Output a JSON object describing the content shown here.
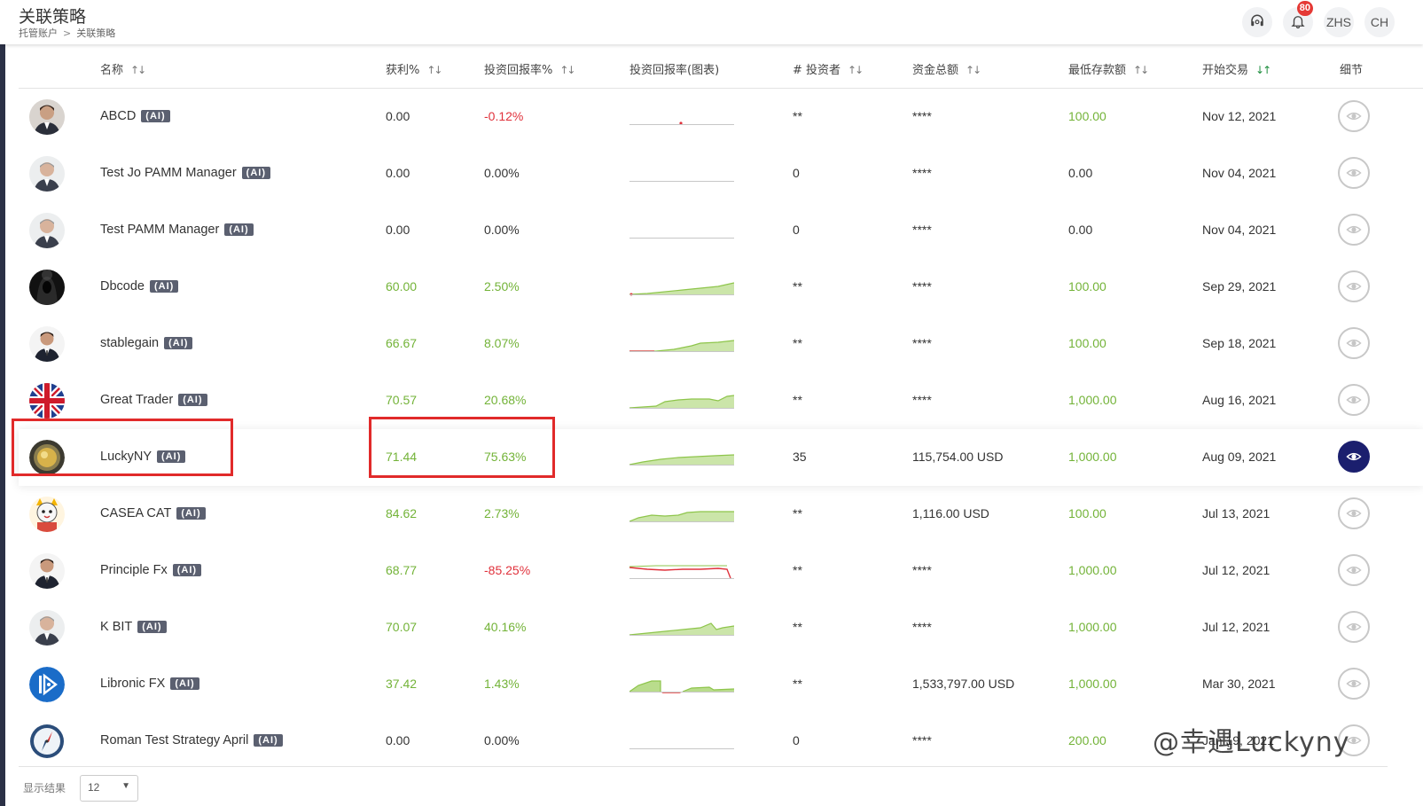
{
  "header": {
    "title": "关联策略",
    "breadcrumb": [
      "托管账户",
      "关联策略"
    ],
    "breadcrumb_sep": ">",
    "notification_count": "80",
    "lang_label": "ZHS",
    "user_label": "CH"
  },
  "columns": {
    "name": "名称",
    "profit": "获利%",
    "roi": "投资回报率%",
    "roi_chart": "投资回报率(图表)",
    "investors": "# 投资者",
    "total_funds": "资金总额",
    "min_deposit": "最低存款额",
    "start": "开始交易",
    "details": "细节"
  },
  "ai_badge": "(AI)",
  "rows": [
    {
      "name": "ABCD",
      "profit": "0.00",
      "roi": "-0.12%",
      "investors": "**",
      "funds": "****",
      "min_deposit": "100.00",
      "start": "Nov 12, 2021",
      "profit_color": "neutral",
      "roi_color": "red",
      "min_color": "green",
      "avatar": "man-portrait-icon",
      "spark": "flat-dot"
    },
    {
      "name": "Test Jo PAMM Manager",
      "profit": "0.00",
      "roi": "0.00%",
      "investors": "0",
      "funds": "****",
      "min_deposit": "0.00",
      "start": "Nov 04, 2021",
      "profit_color": "neutral",
      "roi_color": "neutral",
      "min_color": "neutral",
      "avatar": "man-grey-portrait-icon",
      "spark": "flat"
    },
    {
      "name": "Test PAMM Manager",
      "profit": "0.00",
      "roi": "0.00%",
      "investors": "0",
      "funds": "****",
      "min_deposit": "0.00",
      "start": "Nov 04, 2021",
      "profit_color": "neutral",
      "roi_color": "neutral",
      "min_color": "neutral",
      "avatar": "man-grey-portrait-icon",
      "spark": "flat"
    },
    {
      "name": "Dbcode",
      "profit": "60.00",
      "roi": "2.50%",
      "investors": "**",
      "funds": "****",
      "min_deposit": "100.00",
      "start": "Sep 29, 2021",
      "profit_color": "green",
      "roi_color": "green",
      "min_color": "green",
      "avatar": "hooded-figure-icon",
      "spark": "rise"
    },
    {
      "name": "stablegain",
      "profit": "66.67",
      "roi": "8.07%",
      "investors": "**",
      "funds": "****",
      "min_deposit": "100.00",
      "start": "Sep 18, 2021",
      "profit_color": "green",
      "roi_color": "green",
      "min_color": "green",
      "avatar": "man-suit-portrait-icon",
      "spark": "step-rise"
    },
    {
      "name": "Great Trader",
      "profit": "70.57",
      "roi": "20.68%",
      "investors": "**",
      "funds": "****",
      "min_deposit": "1,000.00",
      "start": "Aug 16, 2021",
      "profit_color": "green",
      "roi_color": "green",
      "min_color": "green",
      "avatar": "uk-flag-icon",
      "spark": "wavy-rise"
    },
    {
      "name": "LuckyNY",
      "profit": "71.44",
      "roi": "75.63%",
      "investors": "35",
      "funds": "115,754.00 USD",
      "min_deposit": "1,000.00",
      "start": "Aug 09, 2021",
      "profit_color": "green",
      "roi_color": "green",
      "min_color": "green",
      "avatar": "gold-coin-icon",
      "spark": "steady-rise",
      "active": true
    },
    {
      "name": "CASEA CAT",
      "profit": "84.62",
      "roi": "2.73%",
      "investors": "**",
      "funds": "1,116.00 USD",
      "min_deposit": "100.00",
      "start": "Jul 13, 2021",
      "profit_color": "green",
      "roi_color": "green",
      "min_color": "green",
      "avatar": "cartoon-cat-icon",
      "spark": "plateau"
    },
    {
      "name": "Principle Fx",
      "profit": "68.77",
      "roi": "-85.25%",
      "investors": "**",
      "funds": "****",
      "min_deposit": "1,000.00",
      "start": "Jul 12, 2021",
      "profit_color": "green",
      "roi_color": "red",
      "min_color": "green",
      "avatar": "man-suit-portrait-icon",
      "spark": "drop"
    },
    {
      "name": "K BIT",
      "profit": "70.07",
      "roi": "40.16%",
      "investors": "**",
      "funds": "****",
      "min_deposit": "1,000.00",
      "start": "Jul 12, 2021",
      "profit_color": "green",
      "roi_color": "green",
      "min_color": "green",
      "avatar": "man-grey-portrait-icon",
      "spark": "rise-spike"
    },
    {
      "name": "Libronic FX",
      "profit": "37.42",
      "roi": "1.43%",
      "investors": "**",
      "funds": "1,533,797.00 USD",
      "min_deposit": "1,000.00",
      "start": "Mar 30, 2021",
      "profit_color": "green",
      "roi_color": "green",
      "min_color": "green",
      "avatar": "libronic-logo-icon",
      "spark": "mixed"
    },
    {
      "name": "Roman Test Strategy April",
      "profit": "0.00",
      "roi": "0.00%",
      "investors": "0",
      "funds": "****",
      "min_deposit": "200.00",
      "start": "Jan 19, 2021",
      "profit_color": "neutral",
      "roi_color": "neutral",
      "min_color": "green",
      "avatar": "compass-icon",
      "spark": "flat"
    }
  ],
  "footer": {
    "results_label": "显示结果",
    "page_size": "12"
  },
  "watermark": "@幸遇Luckyny",
  "colors": {
    "green": "#73b338",
    "red": "#e0313b",
    "active_eye": "#1b1f6e",
    "highlight_box": "#e12a2a"
  }
}
